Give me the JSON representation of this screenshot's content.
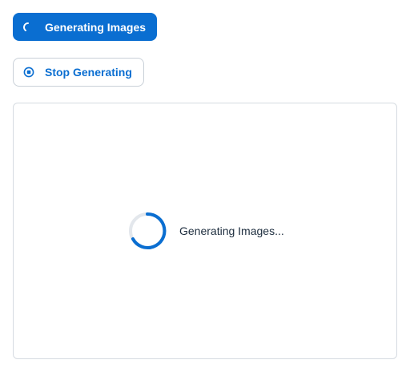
{
  "toolbar": {
    "generate_button_label": "Generating Images",
    "stop_button_label": "Stop Generating"
  },
  "panel": {
    "status_text": "Generating Images..."
  },
  "icons": {
    "generate_button_icon": "spinner-icon",
    "stop_button_icon": "stop-circle-icon",
    "panel_loader_icon": "spinner-icon"
  },
  "colors": {
    "accent": "#0a6ed1",
    "panel_border": "#d6dbe1",
    "text": "#1d2d3e"
  }
}
